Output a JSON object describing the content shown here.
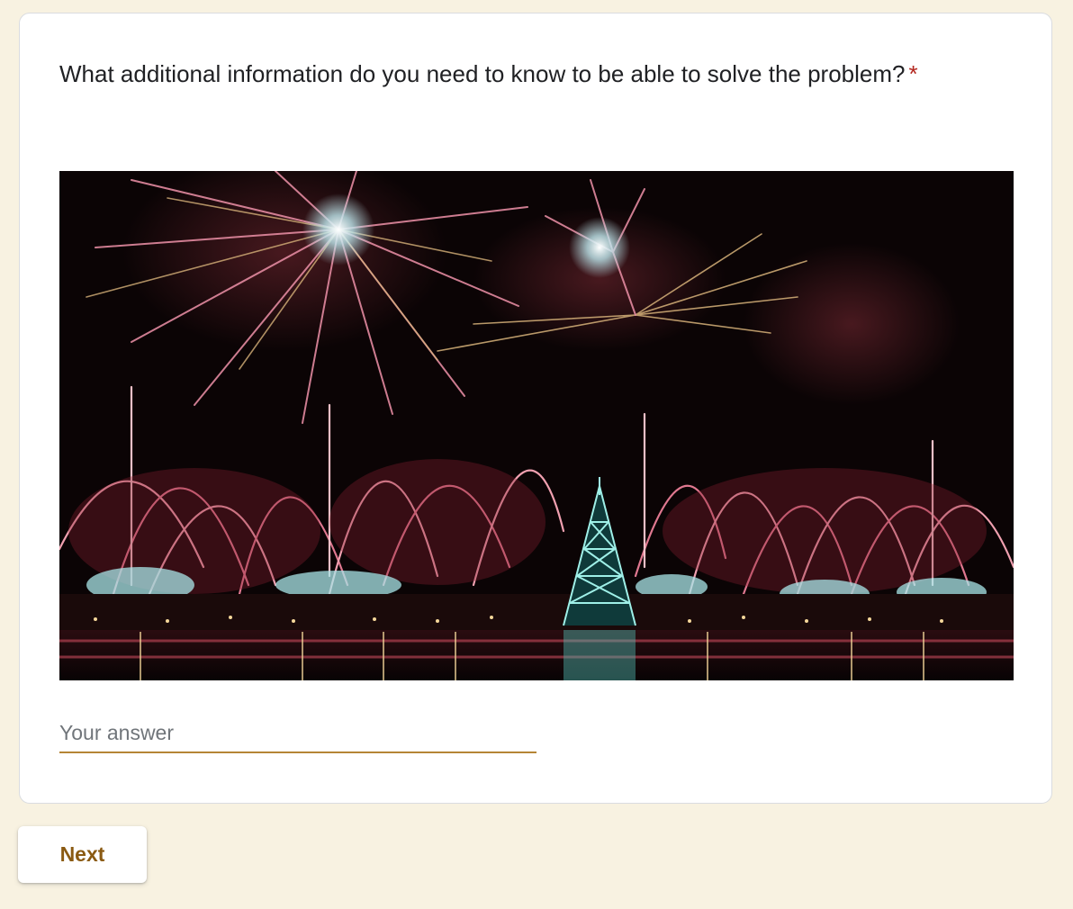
{
  "question": {
    "text": "What additional information do you need to know to be able to solve the problem?",
    "required_marker": "*"
  },
  "image": {
    "description_icon": "fireworks-photo"
  },
  "answer": {
    "placeholder": "Your answer",
    "value": ""
  },
  "navigation": {
    "next_label": "Next"
  },
  "colors": {
    "page_background": "#f8f2e1",
    "accent": "#b58535",
    "button_text": "#8a5a12",
    "required": "#b3261e"
  }
}
